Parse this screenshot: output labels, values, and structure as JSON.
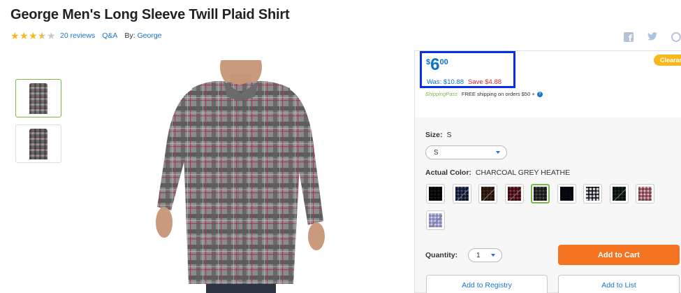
{
  "product": {
    "title": "George Men's Long Sleeve Twill Plaid Shirt",
    "rating_stars": 3.5,
    "reviews_label": "20 reviews",
    "qa_label": "Q&A",
    "by_label": "By:",
    "brand": "George"
  },
  "social": {
    "icons": [
      "facebook-icon",
      "twitter-icon",
      "pinterest-icon"
    ]
  },
  "price": {
    "currency": "$",
    "whole": "6",
    "cents": "00",
    "was": "Was: $10.88",
    "save": "Save $4.88",
    "badge": "Clearan"
  },
  "shipping": {
    "pass_label": "ShippingPass",
    "free_text": "FREE shipping on orders $50 +",
    "help_icon": "?"
  },
  "size": {
    "label": "Size:",
    "value": "S",
    "selected": "S"
  },
  "color": {
    "label": "Actual Color:",
    "value": "CHARCOAL GREY HEATHE",
    "swatches": [
      {
        "name": "black-stripe",
        "colors": [
          "#1e1e1e",
          "#555555"
        ],
        "unavailable": false
      },
      {
        "name": "navy-plaid",
        "colors": [
          "#3a4a6a",
          "#8f99b3"
        ],
        "unavailable": true
      },
      {
        "name": "brown-plaid",
        "colors": [
          "#5b4234",
          "#8a6a52"
        ],
        "unavailable": true
      },
      {
        "name": "red-plaid",
        "colors": [
          "#7a2f3b",
          "#b8858d"
        ],
        "unavailable": true
      },
      {
        "name": "charcoal-grey-heather",
        "colors": [
          "#4c4c4c",
          "#8e8e8e"
        ],
        "unavailable": false,
        "selected": true
      },
      {
        "name": "dark-navy",
        "colors": [
          "#1f2236",
          "#2c3050"
        ],
        "unavailable": false
      },
      {
        "name": "white-black-plaid",
        "colors": [
          "#e8e8ec",
          "#3a3a44"
        ],
        "unavailable": true
      },
      {
        "name": "green-plaid",
        "colors": [
          "#2b3e33",
          "#5b6f61"
        ],
        "unavailable": true
      },
      {
        "name": "red-white-plaid",
        "colors": [
          "#b47c84",
          "#efe4e6"
        ],
        "unavailable": true
      },
      {
        "name": "lavender-plaid",
        "colors": [
          "#b7b8da",
          "#e7e7f4"
        ],
        "unavailable": true
      }
    ]
  },
  "quantity": {
    "label": "Quantity:",
    "value": "1"
  },
  "actions": {
    "add_to_cart": "Add to Cart",
    "add_to_registry": "Add to Registry",
    "add_to_list": "Add to List"
  },
  "colors": {
    "accent_blue": "#1a75cf",
    "price_blue": "#0a73c9",
    "save_red": "#d2282a",
    "cart_orange": "#f47321",
    "star_gold": "#f8b81c",
    "highlight_border": "#0a2ee6",
    "selected_green": "#7ab648"
  }
}
